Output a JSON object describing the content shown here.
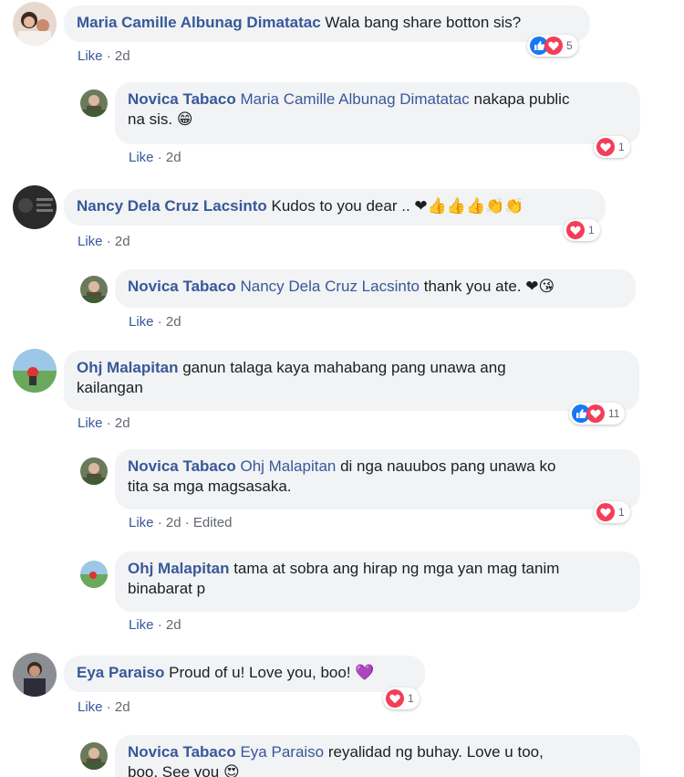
{
  "colors": {
    "author": "#385898",
    "bubble": "#f2f3f5",
    "like_blue": "#1877f2",
    "love_red": "#f33e58"
  },
  "comments": [
    {
      "author": "Maria Camille Albunag Dimatatac",
      "text": "Wala bang share botton sis?",
      "like": "Like",
      "sep": "·",
      "time": "2d",
      "reactions": {
        "icons": [
          "like-icon",
          "love-icon"
        ],
        "count": "5"
      },
      "replies": [
        {
          "author": "Novica Tabaco",
          "mention": "Maria Camille Albunag Dimatatac",
          "text_line1": "nakapa public",
          "text_line2": "na sis.",
          "emoji": "😁",
          "like": "Like",
          "sep": "·",
          "time": "2d",
          "reactions": {
            "icons": [
              "love-icon"
            ],
            "count": "1"
          }
        }
      ]
    },
    {
      "author": "Nancy Dela Cruz Lacsinto",
      "text": "Kudos to you dear ..",
      "emoji": "❤👍👍👍👏👏",
      "like": "Like",
      "sep": "·",
      "time": "2d",
      "reactions": {
        "icons": [
          "love-icon"
        ],
        "count": "1"
      },
      "replies": [
        {
          "author": "Novica Tabaco",
          "mention": "Nancy Dela Cruz Lacsinto",
          "text": "thank you ate.",
          "emoji": "❤😘",
          "like": "Like",
          "sep": "·",
          "time": "2d"
        }
      ]
    },
    {
      "author": "Ohj Malapitan",
      "text_line1": "ganun talaga kaya mahabang pang unawa ang",
      "text_line2": "kailangan",
      "like": "Like",
      "sep": "·",
      "time": "2d",
      "reactions": {
        "icons": [
          "like-icon",
          "love-icon"
        ],
        "count": "11"
      },
      "replies": [
        {
          "author": "Novica Tabaco",
          "mention": "Ohj Malapitan",
          "text_line1": "di nga nauubos pang unawa ko",
          "text_line2": "tita sa mga magsasaka.",
          "like": "Like",
          "sep": "·",
          "time": "2d",
          "edited": "Edited",
          "reactions": {
            "icons": [
              "love-icon"
            ],
            "count": "1"
          }
        },
        {
          "author": "Ohj Malapitan",
          "text_line1": "tama at sobra ang hirap ng mga yan mag tanim",
          "text_line2": "binabarat p",
          "like": "Like",
          "sep": "·",
          "time": "2d"
        }
      ]
    },
    {
      "author": "Eya Paraiso",
      "text": "Proud of u! Love you, boo!",
      "emoji": "💜",
      "like": "Like",
      "sep": "·",
      "time": "2d",
      "reactions": {
        "icons": [
          "love-icon"
        ],
        "count": "1"
      },
      "replies": [
        {
          "author": "Novica Tabaco",
          "mention": "Eya Paraiso",
          "text_line1": "reyalidad ng buhay. Love u too,",
          "text_line2": "boo. See you",
          "emoji": "😍"
        }
      ]
    }
  ]
}
